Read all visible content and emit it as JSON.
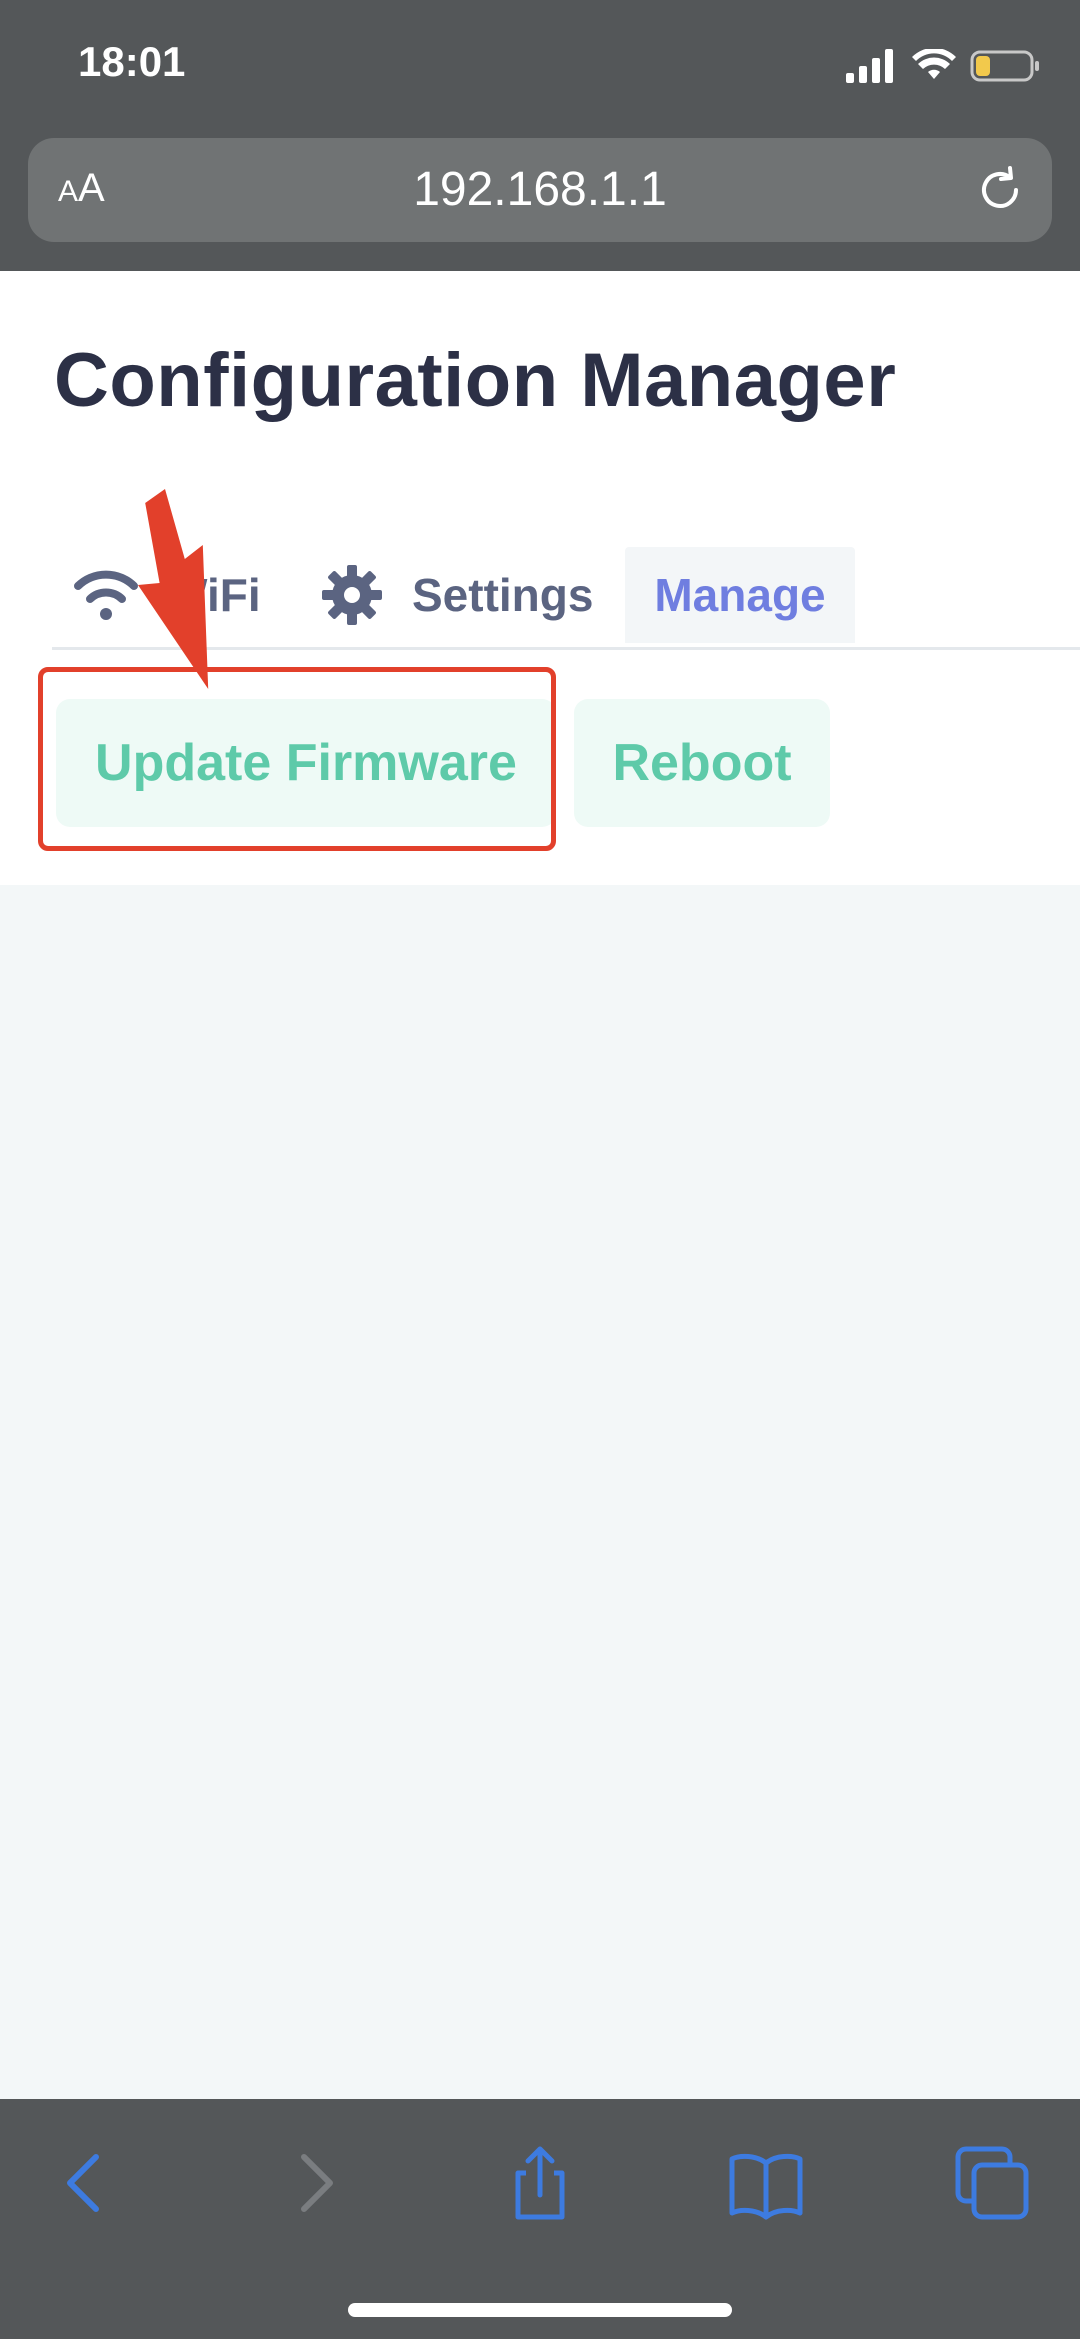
{
  "status_bar": {
    "time": "18:01",
    "icons": [
      "signal-icon",
      "wifi-icon",
      "battery-icon"
    ]
  },
  "address_bar": {
    "text_size_label_small": "A",
    "text_size_label_large": "A",
    "url": "192.168.1.1",
    "reload_icon": "reload-icon"
  },
  "page": {
    "title": "Configuration Manager",
    "tabs": [
      {
        "label": "WiFi",
        "icon": "wifi-icon",
        "active": false
      },
      {
        "label": "Settings",
        "icon": "gear-icon",
        "active": false
      },
      {
        "label": "Manage",
        "icon": null,
        "active": true
      }
    ],
    "buttons": {
      "update_firmware": "Update Firmware",
      "reboot": "Reboot"
    }
  },
  "annotation": {
    "arrow_color": "#e2402b",
    "highlight_color": "#e2402b"
  },
  "toolbar": {
    "items": [
      "back-icon",
      "forward-icon",
      "share-icon",
      "bookmarks-icon",
      "tabs-icon"
    ]
  },
  "colors": {
    "title": "#2c3046",
    "tab_text": "#5b6481",
    "tab_active_text": "#6f7ee0",
    "button_text": "#5ecaa9",
    "button_bg": "#eefaf6",
    "browser_chrome": "#545759",
    "toolbar_icon": "#3d7be0"
  }
}
